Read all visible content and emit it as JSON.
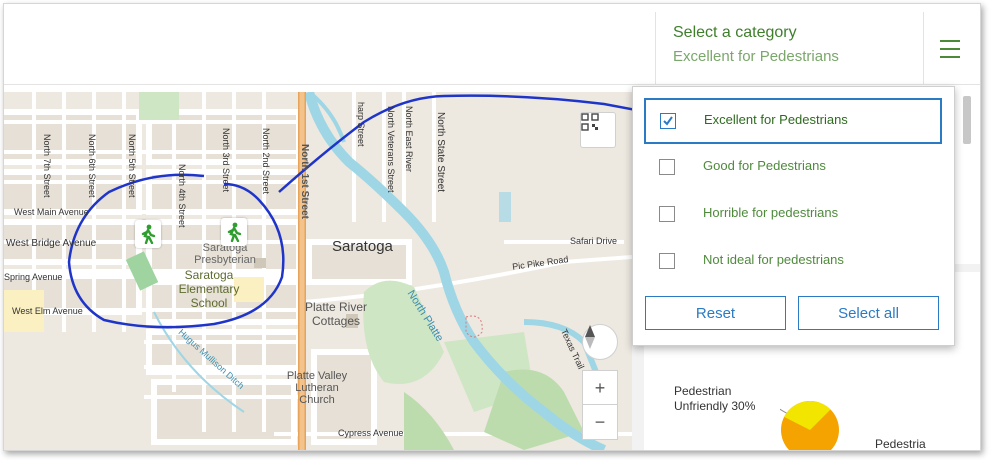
{
  "category": {
    "title": "Select a category",
    "selected_value": "Excellent for Pedestrians"
  },
  "dropdown": {
    "options": [
      {
        "label": "Excellent for Pedestrians",
        "checked": true
      },
      {
        "label": "Good for Pedestrians",
        "checked": false
      },
      {
        "label": "Horrible for pedestrians",
        "checked": false
      },
      {
        "label": "Not ideal for pedestrians",
        "checked": false
      }
    ],
    "reset_label": "Reset",
    "select_all_label": "Select all"
  },
  "map": {
    "city": "Saratoga",
    "streets": {
      "north_7th": "North 7th Street",
      "north_6th": "North 6th Street",
      "north_5th": "North 5th Street",
      "north_4th": "North 4th Street",
      "north_3rd": "North 3rd Street",
      "north_2nd": "North 2nd Street",
      "north_1st": "North 1st Street",
      "north_state": "North State Street",
      "north_east_river": "North East River",
      "north_veterans": "North Veterans Street",
      "sharp": "harp Street",
      "west_main": "West Main Avenue",
      "west_bridge": "West Bridge Avenue",
      "spring": "Spring Avenue",
      "west_elm": "West Elm Avenue",
      "pic_pike": "Pic Pike Road",
      "safari": "Safari Drive",
      "cypress": "Cypress Avenue",
      "texas_trail": "Texas Trail",
      "north_platte": "North Platte",
      "mullison": "Hugus Mullison Ditch"
    },
    "pois": {
      "presbyterian": "Saratoga Presbyterian",
      "school": "Saratoga Elementary School",
      "cottages": "Platte River Cottages",
      "lutheran": "Platte Valley Lutheran Church"
    },
    "zoom_in": "+",
    "zoom_out": "−"
  },
  "chart_labels": {
    "unfriendly": "Pedestrian Unfriendly 30%",
    "second": "Pedestria"
  },
  "chart_data": {
    "type": "pie",
    "categories": [
      "Pedestrian Unfriendly"
    ],
    "values": [
      30
    ]
  },
  "colors": {
    "accent_green": "#3f7f2c",
    "accent_blue": "#2b7bc4",
    "annotation": "#1f35c9",
    "pie_orange": "#f4a300",
    "pie_yellow": "#f2e600"
  }
}
